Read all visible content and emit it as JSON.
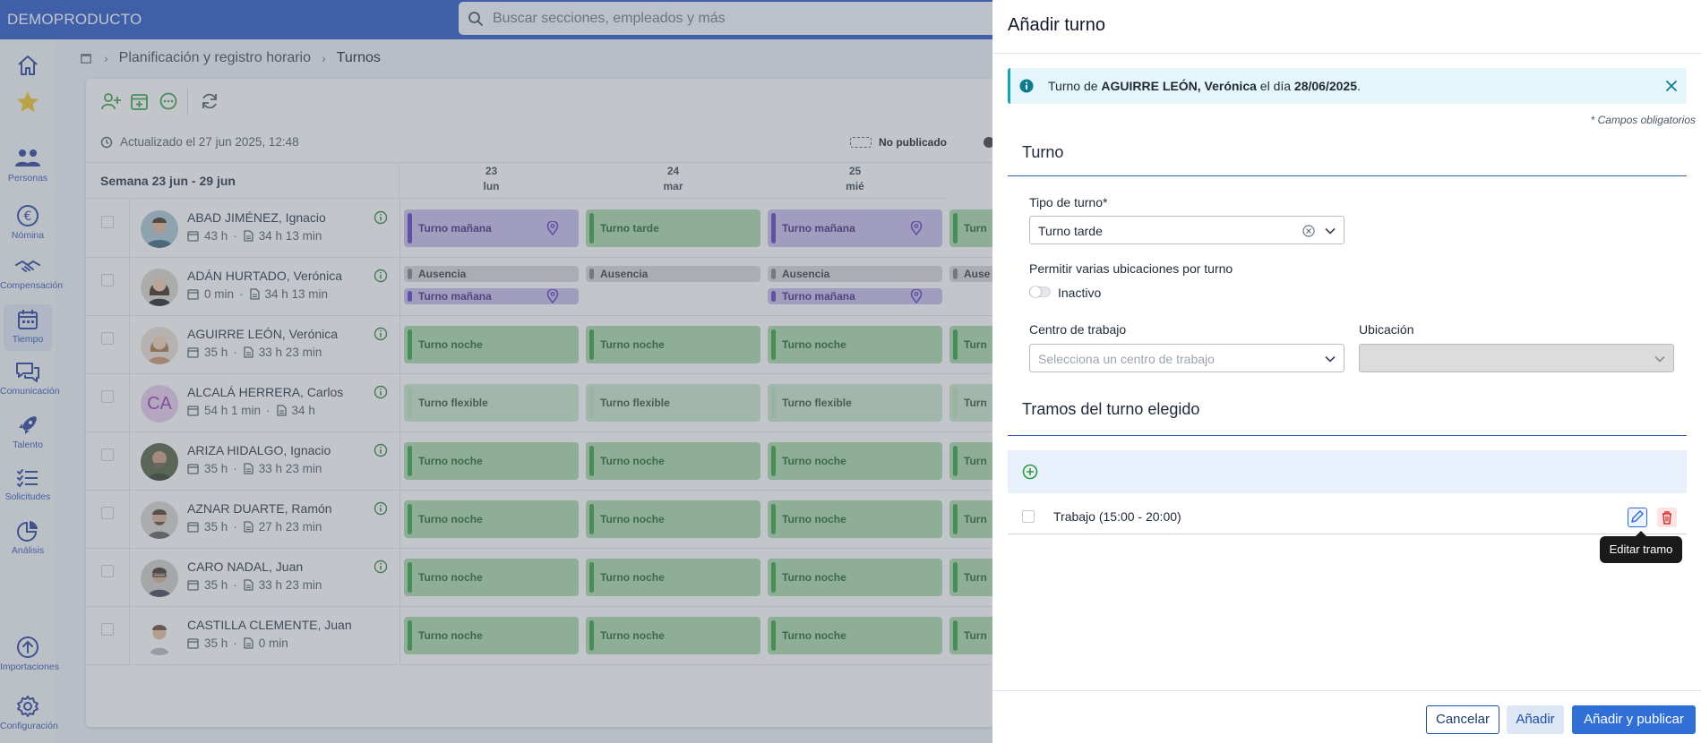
{
  "app": {
    "brand": "DEMOPRODUCTO"
  },
  "search": {
    "placeholder": "Buscar secciones, empleados y más"
  },
  "nav": {
    "personas": "Personas",
    "nomina": "Nómina",
    "compensacion": "Compensación",
    "tiempo": "Tiempo",
    "comunicacion": "Comunicación",
    "talento": "Talento",
    "solicitudes": "Solicitudes",
    "analisis": "Análisis",
    "importaciones": "Importaciones",
    "configuracion": "Configuración"
  },
  "breadcrumb": {
    "parent": "Planificación y registro horario",
    "current": "Turnos"
  },
  "status": {
    "updated": "Actualizado el 27 jun 2025, 12:48",
    "unpublished": "No publicado"
  },
  "week": {
    "label": "Semana 23 jun - 29 jun",
    "days": [
      {
        "num": "23",
        "name": "lun"
      },
      {
        "num": "24",
        "name": "mar"
      },
      {
        "num": "25",
        "name": "mié"
      }
    ]
  },
  "employees": [
    {
      "name": "ABAD JIMÉNEZ, Ignacio",
      "planned": "43 h",
      "worked": "34 h 13 min"
    },
    {
      "name": "ADÁN HURTADO, Verónica",
      "planned": "0 min",
      "worked": "34 h 13 min"
    },
    {
      "name": "AGUIRRE LEÓN, Verónica",
      "planned": "35 h",
      "worked": "33 h 23 min"
    },
    {
      "name": "ALCALÁ HERRERA, Carlos",
      "planned": "54 h 1 min",
      "worked": "34 h",
      "initials": "CA"
    },
    {
      "name": "ARIZA HIDALGO, Ignacio",
      "planned": "35 h",
      "worked": "33 h 23 min"
    },
    {
      "name": "AZNAR DUARTE, Ramón",
      "planned": "35 h",
      "worked": "27 h 23 min"
    },
    {
      "name": "CARO NADAL, Juan",
      "planned": "35 h",
      "worked": "33 h 23 min"
    },
    {
      "name": "CASTILLA CLEMENTE, Juan",
      "planned": "35 h",
      "worked": "0 min"
    }
  ],
  "shifts": {
    "manana": "Turno mañana",
    "tarde": "Turno tarde",
    "noche": "Turno noche",
    "flexible": "Turno flexible",
    "ausencia": "Ausencia",
    "tur": "Turn",
    "aus": "Ause"
  },
  "drawer": {
    "title": "Añadir turno",
    "alert": {
      "prefix": "Turno de ",
      "employee": "AGUIRRE LEÓN, Verónica",
      "middle": " el día ",
      "date": "28/06/2025",
      "suffix": "."
    },
    "required_note": "* Campos obligatorios",
    "section_turno": "Turno",
    "tipo_label": "Tipo de turno*",
    "tipo_value": "Turno tarde",
    "multi_label": "Permitir varias ubicaciones por turno",
    "multi_state": "Inactivo",
    "centro_label": "Centro de trabajo",
    "centro_placeholder": "Selecciona un centro de trabajo",
    "ubicacion_label": "Ubicación",
    "section_tramos": "Tramos del turno elegido",
    "tramo": "Trabajo (15:00 - 20:00)",
    "tooltip": "Editar tramo",
    "btn_cancel": "Cancelar",
    "btn_add": "Añadir",
    "btn_publish": "Añadir y publicar"
  }
}
